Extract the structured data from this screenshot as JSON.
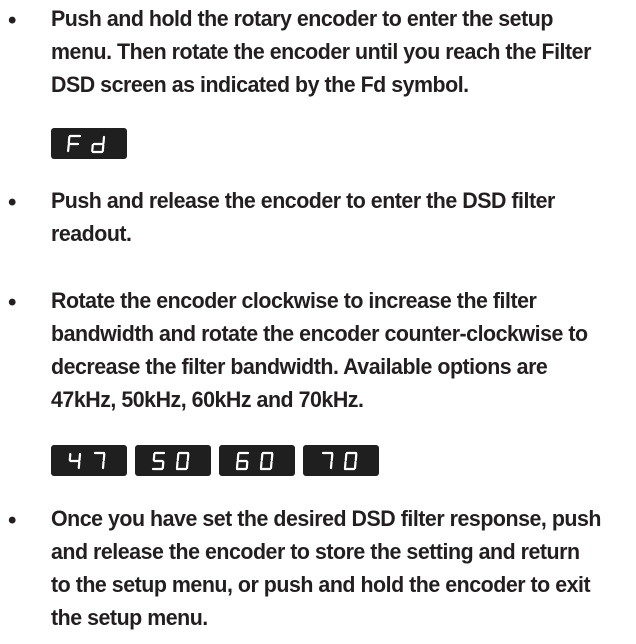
{
  "instructions": [
    {
      "bullet": "•",
      "text": "Push and hold the rotary encoder to enter the setup menu. Then rotate the encoder until you reach the Filter DSD screen as indicated by the Fd symbol.",
      "displays": [
        "Fd"
      ]
    },
    {
      "bullet": "•",
      "text": "Push and release the encoder to enter the DSD filter readout.",
      "displays": []
    },
    {
      "bullet": "•",
      "text": "Rotate the encoder clockwise to increase the filter bandwidth and rotate the encoder counter-clockwise to decrease the filter bandwidth.  Available options are 47kHz, 50kHz, 60kHz and 70kHz.",
      "displays": [
        "47",
        "50",
        "60",
        "70"
      ]
    },
    {
      "bullet": "•",
      "text": "Once you have set the desired DSD filter response, push and release the encoder to store the setting and return to the setup menu, or push and hold the encoder to exit the setup menu.",
      "displays": []
    }
  ],
  "colors": {
    "text": "#231f20",
    "display_background": "#1f1f1f",
    "display_segment": "#ffffff"
  }
}
